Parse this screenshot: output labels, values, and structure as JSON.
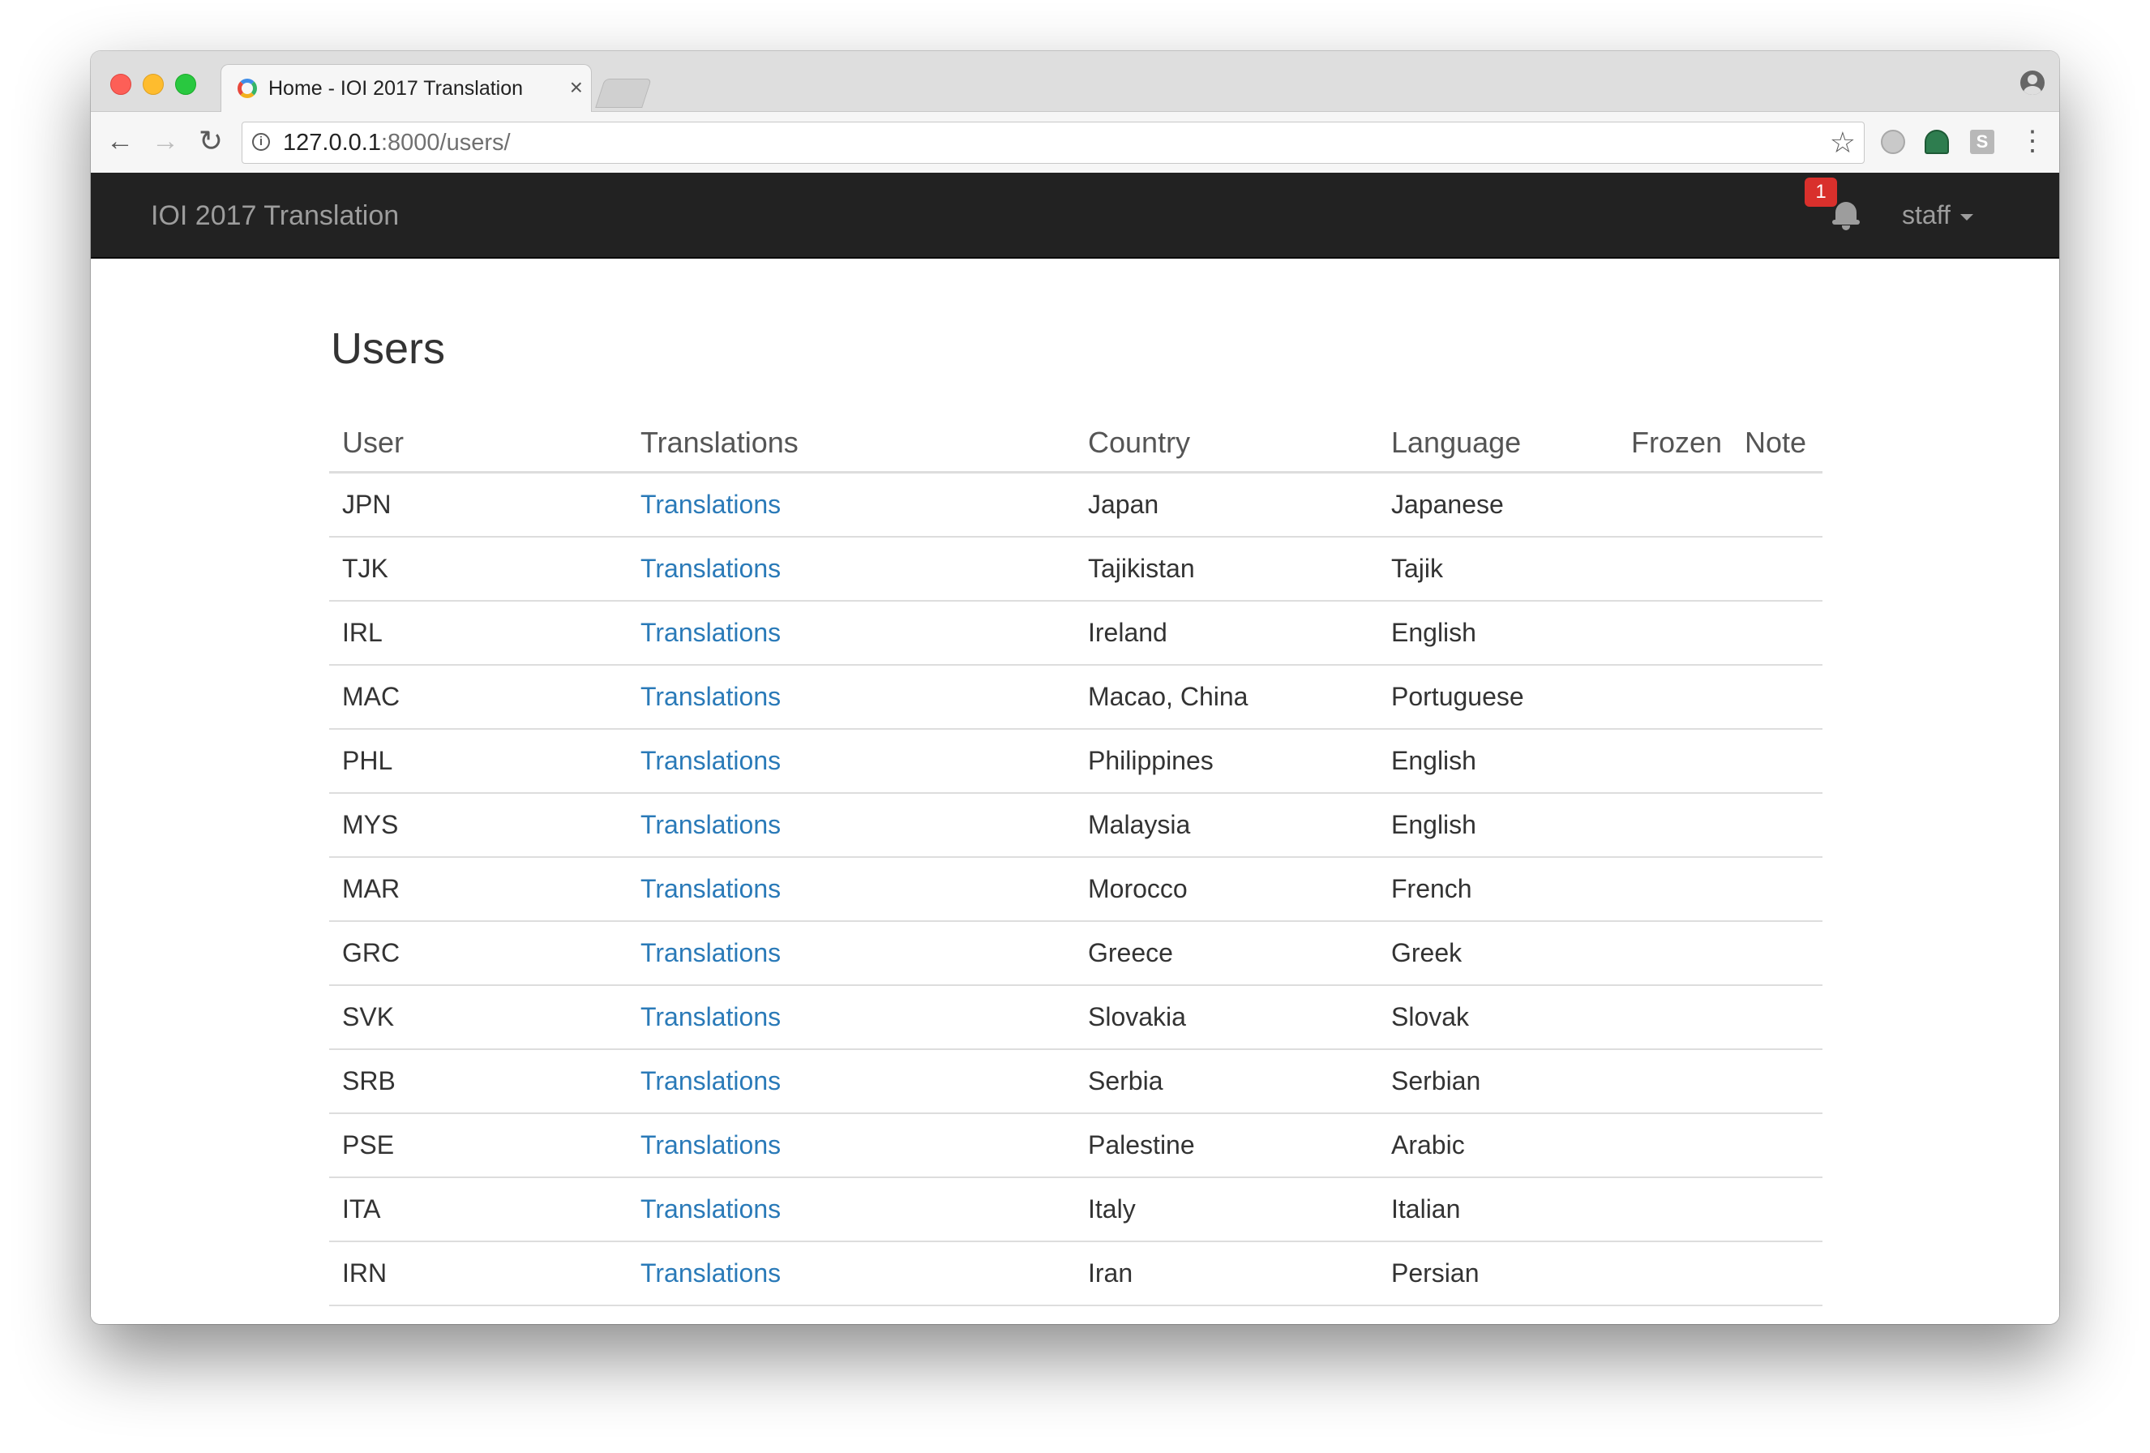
{
  "browser": {
    "tab_title": "Home - IOI 2017 Translation",
    "tab_close": "×",
    "url_host": "127.0.0.1",
    "url_path": ":8000/users/",
    "extension_s_label": "S"
  },
  "navbar": {
    "brand": "IOI 2017 Translation",
    "notification_count": "1",
    "user_menu_label": "staff"
  },
  "page": {
    "title": "Users",
    "columns": [
      "User",
      "Translations",
      "Country",
      "Language",
      "Frozen",
      "Note"
    ],
    "rows": [
      {
        "user": "JPN",
        "translations": "Translations",
        "country": "Japan",
        "language": "Japanese",
        "frozen": "",
        "note": ""
      },
      {
        "user": "TJK",
        "translations": "Translations",
        "country": "Tajikistan",
        "language": "Tajik",
        "frozen": "",
        "note": ""
      },
      {
        "user": "IRL",
        "translations": "Translations",
        "country": "Ireland",
        "language": "English",
        "frozen": "",
        "note": ""
      },
      {
        "user": "MAC",
        "translations": "Translations",
        "country": "Macao, China",
        "language": "Portuguese",
        "frozen": "",
        "note": ""
      },
      {
        "user": "PHL",
        "translations": "Translations",
        "country": "Philippines",
        "language": "English",
        "frozen": "",
        "note": ""
      },
      {
        "user": "MYS",
        "translations": "Translations",
        "country": "Malaysia",
        "language": "English",
        "frozen": "",
        "note": ""
      },
      {
        "user": "MAR",
        "translations": "Translations",
        "country": "Morocco",
        "language": "French",
        "frozen": "",
        "note": ""
      },
      {
        "user": "GRC",
        "translations": "Translations",
        "country": "Greece",
        "language": "Greek",
        "frozen": "",
        "note": ""
      },
      {
        "user": "SVK",
        "translations": "Translations",
        "country": "Slovakia",
        "language": "Slovak",
        "frozen": "",
        "note": ""
      },
      {
        "user": "SRB",
        "translations": "Translations",
        "country": "Serbia",
        "language": "Serbian",
        "frozen": "",
        "note": ""
      },
      {
        "user": "PSE",
        "translations": "Translations",
        "country": "Palestine",
        "language": "Arabic",
        "frozen": "",
        "note": ""
      },
      {
        "user": "ITA",
        "translations": "Translations",
        "country": "Italy",
        "language": "Italian",
        "frozen": "",
        "note": ""
      },
      {
        "user": "IRN",
        "translations": "Translations",
        "country": "Iran",
        "language": "Persian",
        "frozen": "",
        "note": ""
      }
    ]
  },
  "colors": {
    "navbar_bg": "#222222",
    "navbar_text": "#9d9d9d",
    "link": "#2a7ab8",
    "badge": "#d9302c"
  }
}
